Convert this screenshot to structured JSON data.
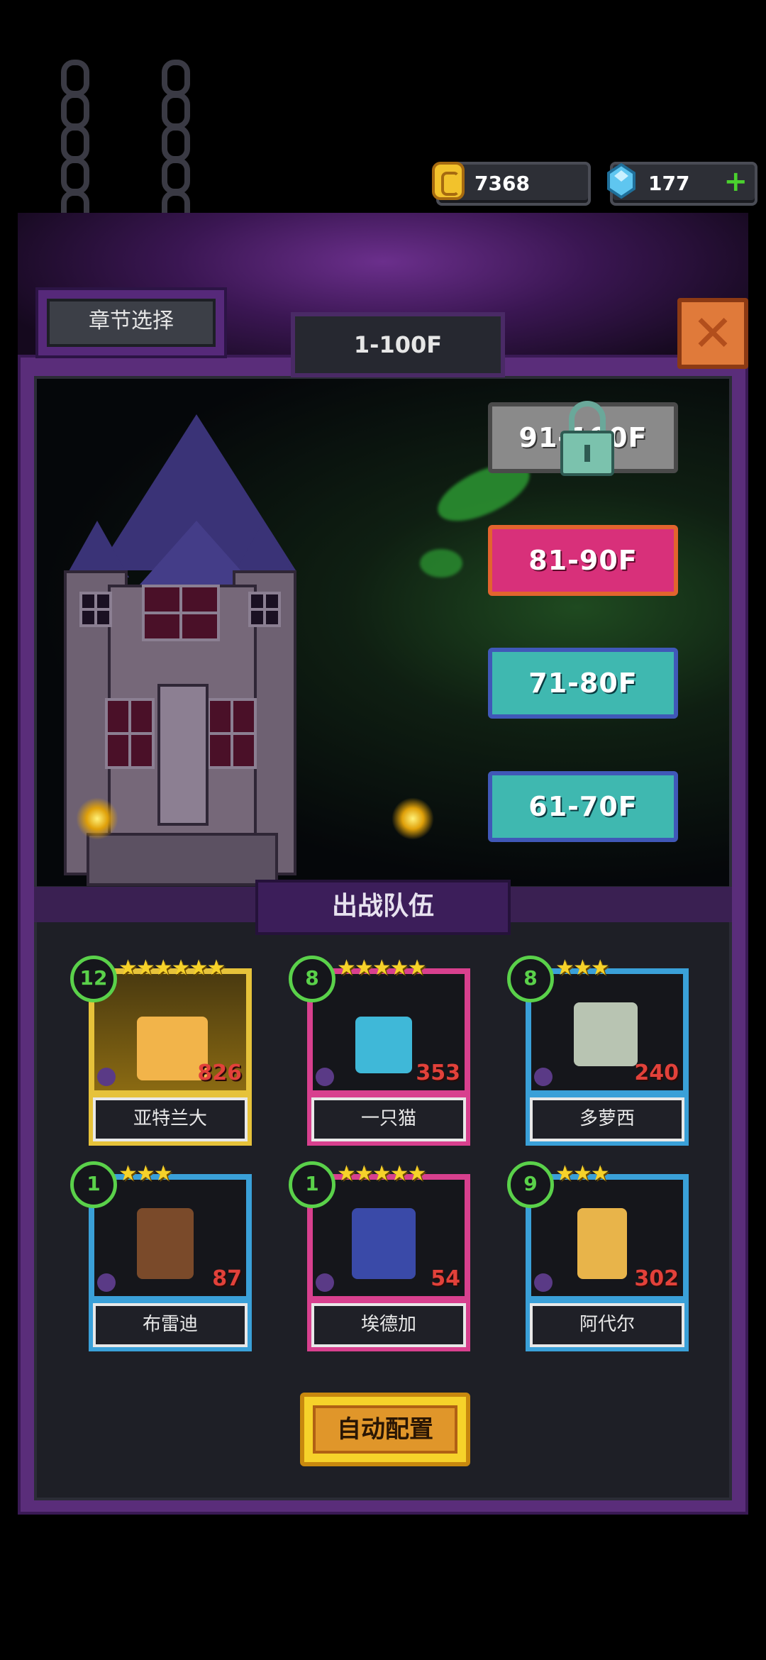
{
  "currency": {
    "gold": "7368",
    "gems": "177"
  },
  "header": {
    "chapter_select": "章节选择",
    "floor_range": "1-100F"
  },
  "floors": [
    {
      "label": "91-100F",
      "locked": true,
      "color": "#8a8a8a"
    },
    {
      "label": "81-90F",
      "locked": false,
      "color": "#d8307a"
    },
    {
      "label": "71-80F",
      "locked": false,
      "color": "#3fb8b0"
    },
    {
      "label": "61-70F",
      "locked": false,
      "color": "#3fb8b0"
    }
  ],
  "team": {
    "title": "出战队伍",
    "heroes": [
      {
        "name": "亚特兰大",
        "level": "12",
        "stars": "★★★★★★",
        "power": "826",
        "frame_color": "#e6c23a"
      },
      {
        "name": "一只猫",
        "level": "8",
        "stars": "★★★★★",
        "power": "353",
        "frame_color": "#d8408e"
      },
      {
        "name": "多萝西",
        "level": "8",
        "stars": "★★★",
        "power": "240",
        "frame_color": "#3aa0d8"
      },
      {
        "name": "布雷迪",
        "level": "1",
        "stars": "★★★",
        "power": "87",
        "frame_color": "#3aa0d8"
      },
      {
        "name": "埃德加",
        "level": "1",
        "stars": "★★★★★",
        "power": "54",
        "frame_color": "#d8408e"
      },
      {
        "name": "阿代尔",
        "level": "9",
        "stars": "★★★",
        "power": "302",
        "frame_color": "#3aa0d8"
      }
    ]
  },
  "auto_button": "自动配置",
  "icons": {
    "coin": "coin-icon",
    "gem": "gem-icon",
    "add": "plus-icon",
    "close": "close-icon",
    "lock": "lock-icon"
  }
}
